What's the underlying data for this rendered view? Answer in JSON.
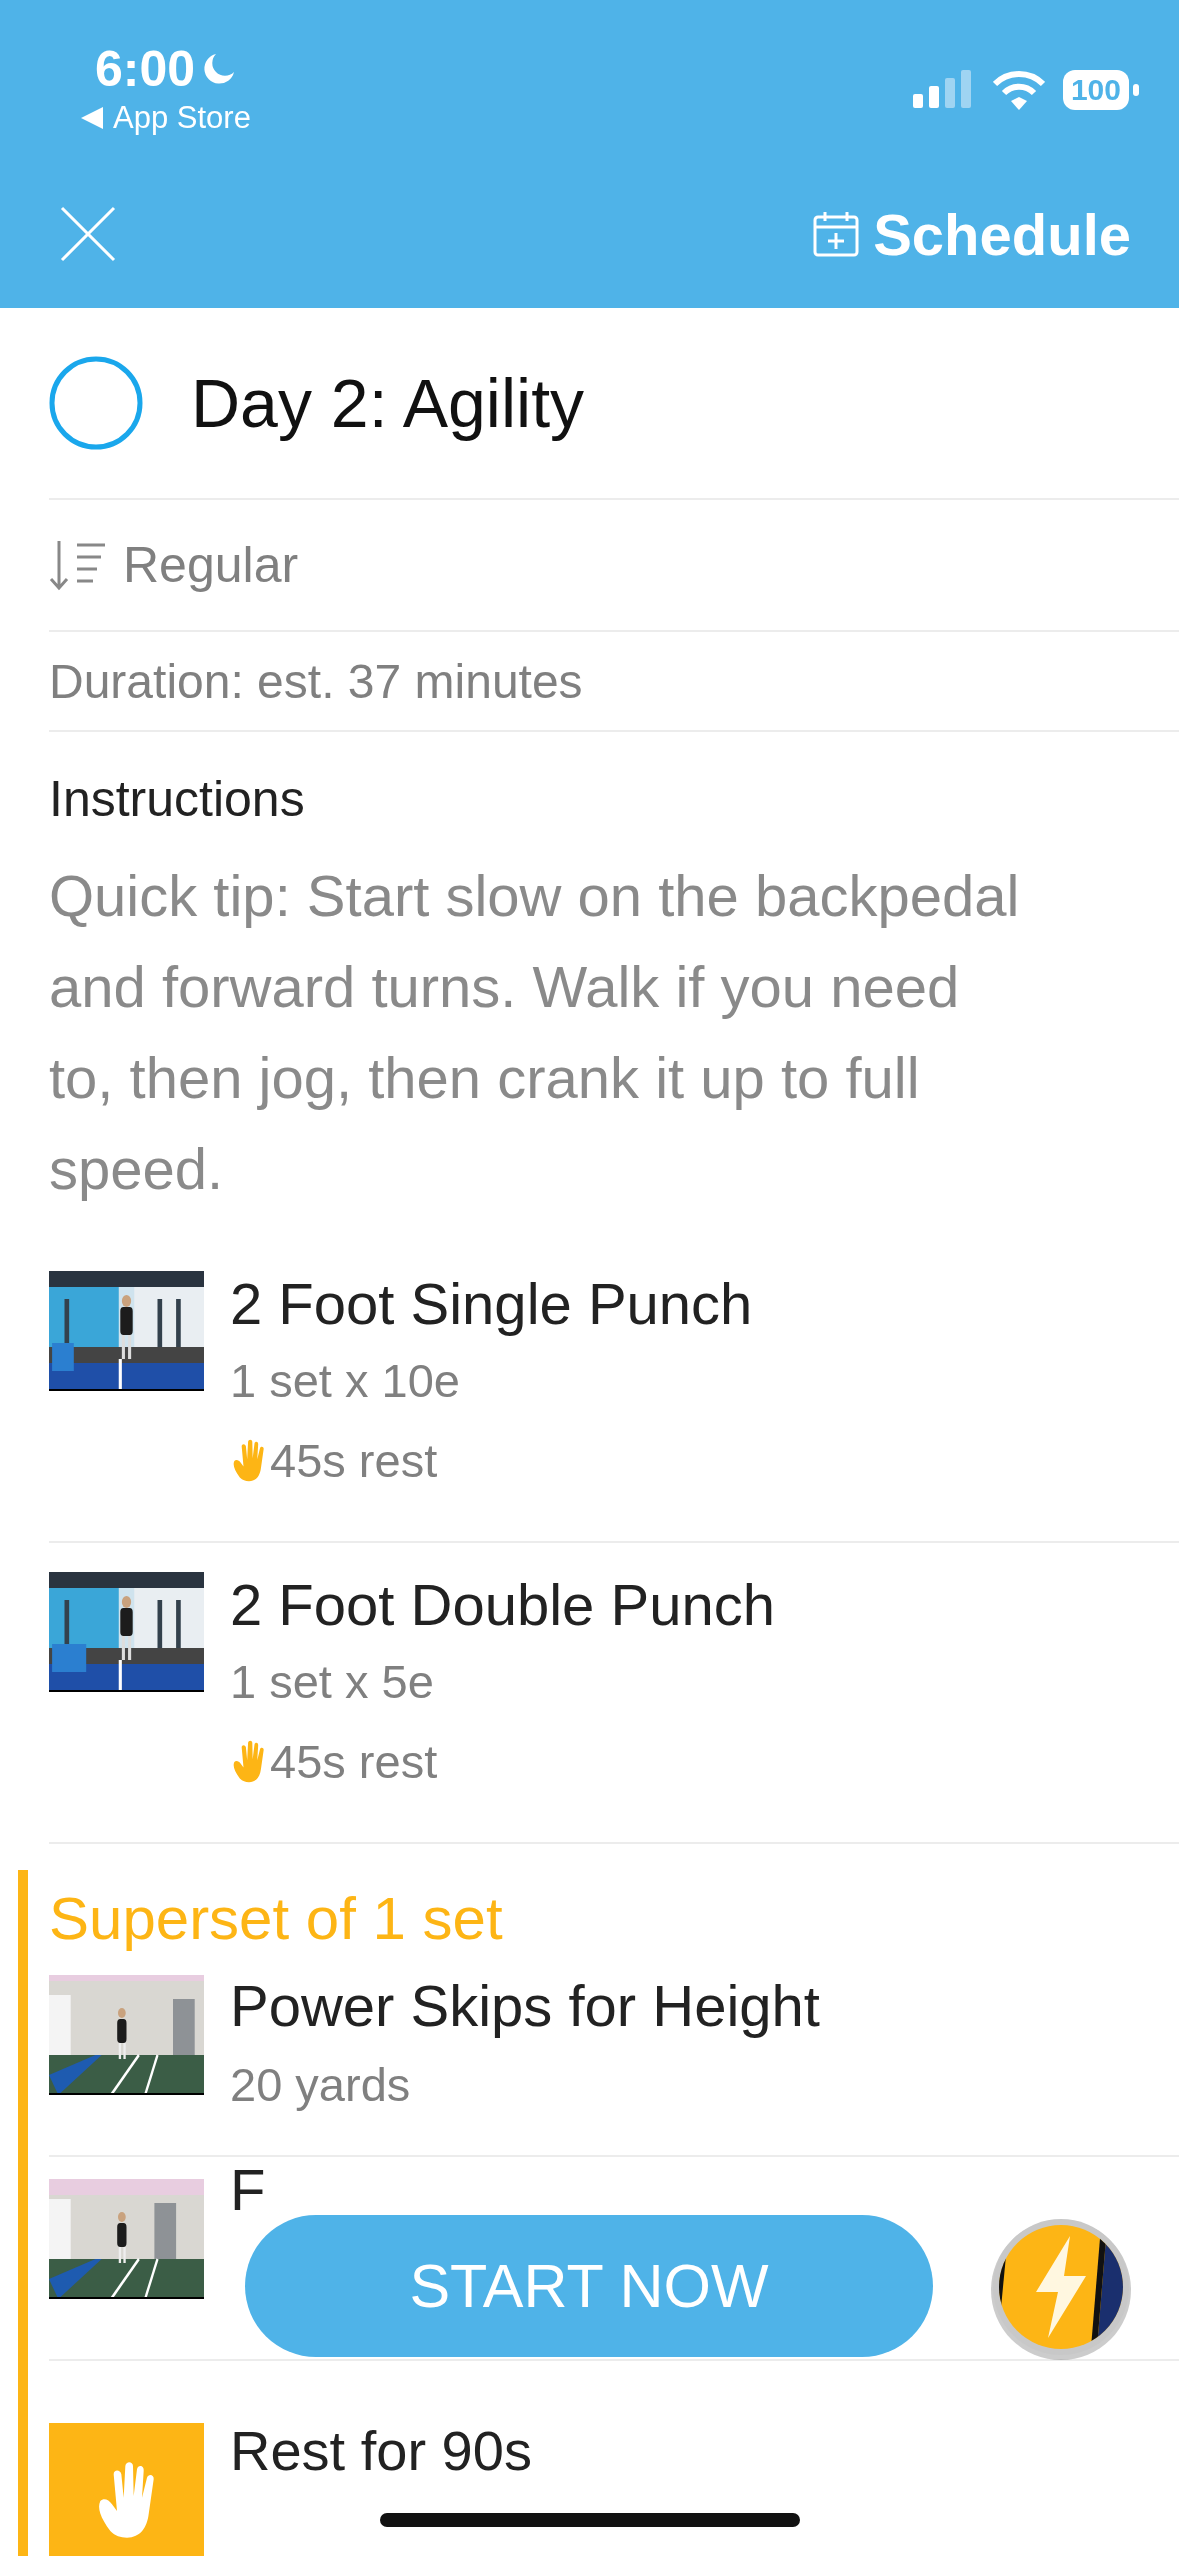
{
  "status_bar": {
    "time": "6:00",
    "back_label": "App Store",
    "battery": "100"
  },
  "header": {
    "schedule_label": "Schedule"
  },
  "workout": {
    "title": "Day 2: Agility",
    "completed": false,
    "order": "Regular",
    "duration": "Duration: est. 37 minutes",
    "instructions_heading": "Instructions",
    "instructions": "Quick tip: Start slow on the backpedal and forward turns. Walk if you need to, then jog, then crank it up to full speed."
  },
  "exercises": [
    {
      "kind": "exercise",
      "title": "2 Foot Single Punch",
      "detail": "1 set x 10e",
      "rest": "45s rest"
    },
    {
      "kind": "exercise",
      "title": "2 Foot Double Punch",
      "detail": "1 set x 5e",
      "rest": "45s rest"
    }
  ],
  "superset": {
    "label": "Superset of 1 set",
    "items": [
      {
        "kind": "exercise",
        "title": "Power Skips for Height",
        "detail": "20 yards"
      },
      {
        "kind": "exercise",
        "title": "F"
      },
      {
        "kind": "rest",
        "title": "Rest for 90s"
      }
    ]
  },
  "start_button": "START NOW"
}
